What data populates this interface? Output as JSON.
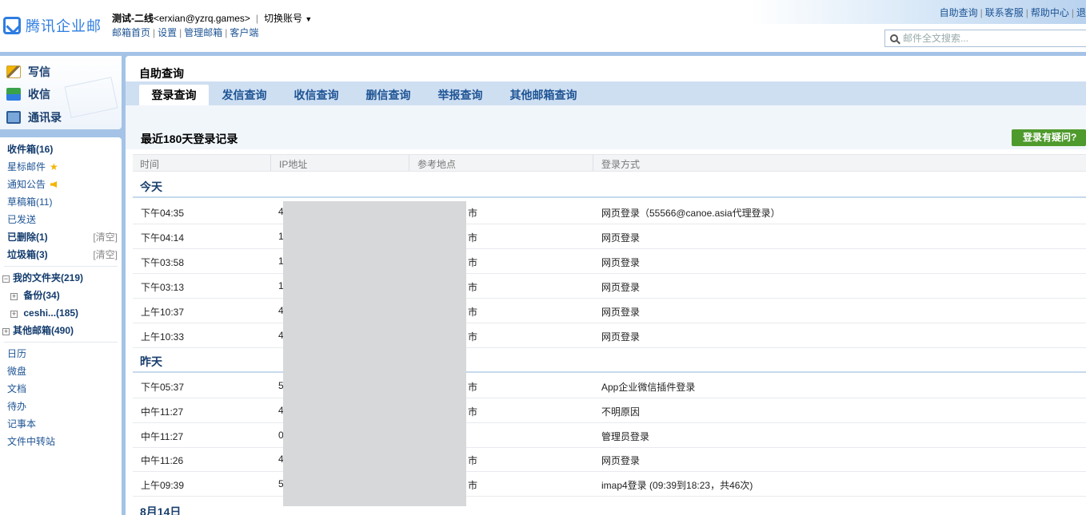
{
  "header": {
    "logo_text": "腾讯企业邮",
    "user_name": "测试-二线",
    "user_email": "<erxian@yzrq.games>",
    "switch_account": "切换账号",
    "sub_links": [
      "邮箱首页",
      "设置",
      "管理邮箱",
      "客户端"
    ],
    "top_links": [
      "自助查询",
      "联系客服",
      "帮助中心",
      "退"
    ],
    "search_placeholder": "邮件全文搜索..."
  },
  "compose": {
    "write": "写信",
    "receive": "收信",
    "contacts": "通讯录"
  },
  "sidebar": {
    "inbox": "收件箱(16)",
    "starred": "星标邮件",
    "notices": "通知公告",
    "drafts": "草稿箱(11)",
    "sent": "已发送",
    "deleted": "已删除(1)",
    "spam": "垃圾箱(3)",
    "clear_label": "[清空]",
    "my_folders": "我的文件夹(219)",
    "folder_backup": "备份(34)",
    "folder_ceshi": "ceshi...(185)",
    "other_mailboxes": "其他邮箱(490)",
    "apps": [
      "日历",
      "微盘",
      "文档",
      "待办",
      "记事本",
      "文件中转站"
    ]
  },
  "main": {
    "page_title": "自助查询",
    "tabs": [
      {
        "label": "登录查询",
        "active": true
      },
      {
        "label": "发信查询",
        "active": false
      },
      {
        "label": "收信查询",
        "active": false
      },
      {
        "label": "删信查询",
        "active": false
      },
      {
        "label": "举报查询",
        "active": false
      },
      {
        "label": "其他邮箱查询",
        "active": false
      }
    ],
    "section_title": "最近180天登录记录",
    "help_button": "登录有疑问?",
    "columns": [
      "时间",
      "IP地址",
      "参考地点",
      "登录方式"
    ],
    "groups": [
      {
        "label": "今天",
        "rows": [
          {
            "time": "下午04:35",
            "ip": "4",
            "location": "市",
            "method": "网页登录（55566@canoe.asia代理登录）"
          },
          {
            "time": "下午04:14",
            "ip": "1",
            "location": "市",
            "method": "网页登录"
          },
          {
            "time": "下午03:58",
            "ip": "1",
            "location": "市",
            "method": "网页登录"
          },
          {
            "time": "下午03:13",
            "ip": "1",
            "location": "市",
            "method": "网页登录"
          },
          {
            "time": "上午10:37",
            "ip": "4",
            "location": "市",
            "method": "网页登录"
          },
          {
            "time": "上午10:33",
            "ip": "4",
            "location": "市",
            "method": "网页登录"
          }
        ]
      },
      {
        "label": "昨天",
        "rows": [
          {
            "time": "下午05:37",
            "ip": "5",
            "location": "市",
            "method": "App企业微信插件登录"
          },
          {
            "time": "中午11:27",
            "ip": "4",
            "location": "市",
            "method": "不明原因"
          },
          {
            "time": "中午11:27",
            "ip": "0",
            "location": "",
            "method": "管理员登录"
          },
          {
            "time": "中午11:26",
            "ip": "4",
            "location": "市",
            "method": "网页登录"
          },
          {
            "time": "上午09:39",
            "ip": "5",
            "location": "市",
            "method": "imap4登录 (09:39到18:23，共46次)"
          }
        ]
      },
      {
        "label": "8月14日",
        "rows": []
      }
    ]
  },
  "colors": {
    "brand_blue": "#2f7de1",
    "frame_blue": "#a4c3e6",
    "tab_bar": "#cfdff2",
    "link_blue": "#1e5494",
    "help_green": "#4f9a2d",
    "mask_gray": "#d7d8da"
  }
}
